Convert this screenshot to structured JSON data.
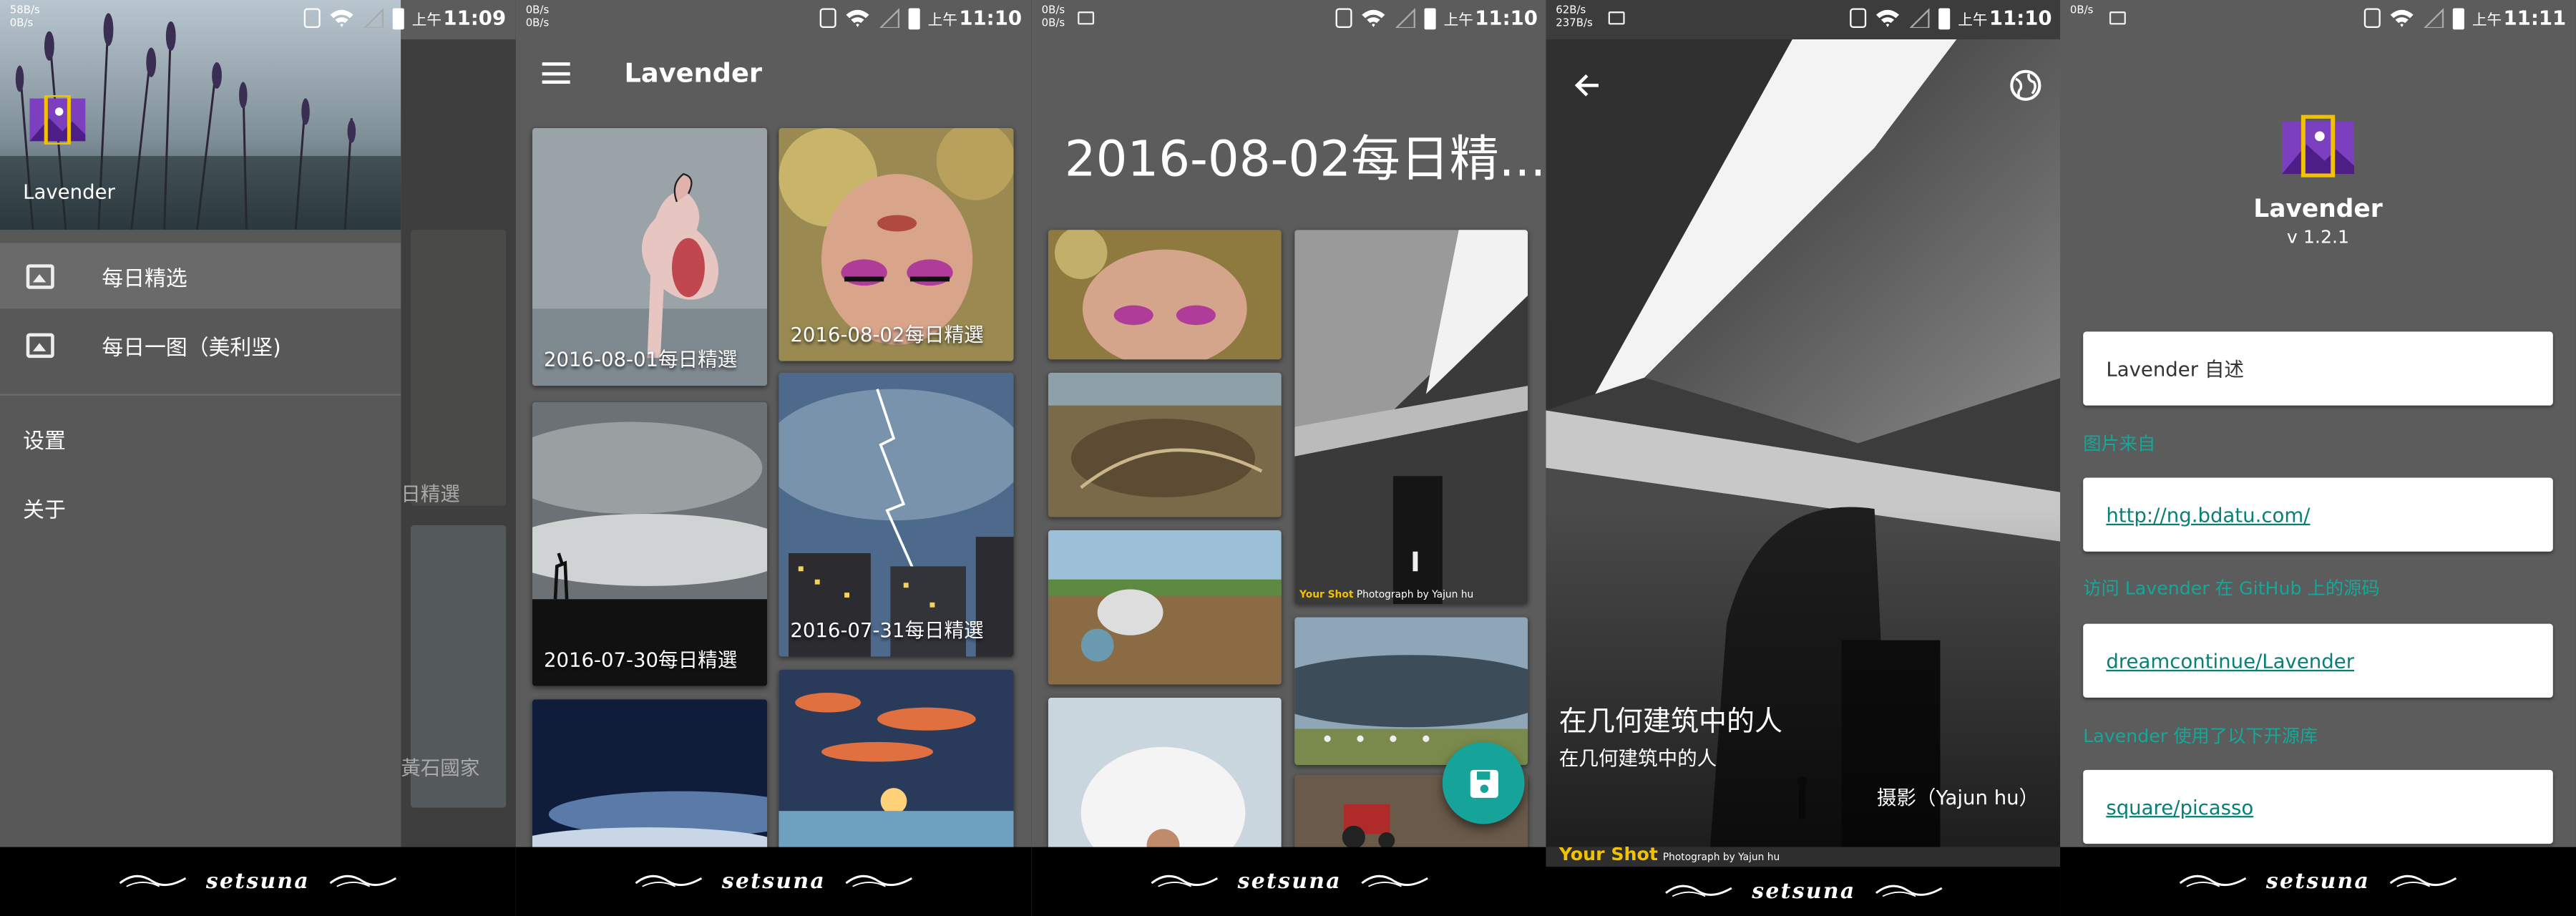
{
  "colors": {
    "panel_bg": "#5c5c5c",
    "drawer_bg": "#585858",
    "accent": "#16a39a",
    "logo_purple": "#7b3fbf",
    "logo_gold": "#f2c200",
    "nav_bar": "#000000"
  },
  "nav_brand": "setsuna",
  "screens": [
    {
      "status": {
        "speed_up": "58B/s",
        "speed_down": "0B/s",
        "ampm": "上午",
        "time": "11:09"
      },
      "drawer": {
        "app_name": "Lavender",
        "menu": [
          {
            "label": "每日精选",
            "icon": "image-icon",
            "selected": true
          },
          {
            "label": "每日一图（美利坚)",
            "icon": "image-icon",
            "selected": false
          }
        ],
        "settings_label": "设置",
        "about_label": "关于"
      },
      "behind_captions": [
        "日精選",
        "黃石國家"
      ]
    },
    {
      "status": {
        "speed_up": "0B/s",
        "speed_down": "0B/s",
        "ampm": "上午",
        "time": "11:10"
      },
      "toolbar_title": "Lavender",
      "cards": [
        {
          "caption": "2016-08-01每日精選"
        },
        {
          "caption": "2016-08-02每日精選"
        },
        {
          "caption": "2016-07-30每日精選"
        },
        {
          "caption": "2016-07-31每日精選"
        }
      ]
    },
    {
      "status": {
        "speed_up": "0B/s",
        "speed_down": "0B/s",
        "ampm": "上午",
        "time": "11:10"
      },
      "title": "2016-08-02每日精...",
      "photo_credit_brand": "Your Shot",
      "photo_credit_text": "Photograph by Yajun hu"
    },
    {
      "status": {
        "speed_up": "62B/s",
        "speed_down": "237B/s",
        "ampm": "上午",
        "time": "11:10"
      },
      "photo_title": "在几何建筑中的人",
      "photo_subtitle": "在几何建筑中的人",
      "photographer": "摄影（Yajun hu）",
      "credit_brand": "Your Shot",
      "credit_text": "Photograph by Yajun hu"
    },
    {
      "status": {
        "speed_up": "0B/s",
        "speed_down": "",
        "ampm": "上午",
        "time": "11:11"
      },
      "app_name": "Lavender",
      "version": "v 1.2.1",
      "items": [
        {
          "heading": "",
          "text": "Lavender 自述",
          "link": false
        },
        {
          "heading": "图片来自",
          "text": "http://ng.bdatu.com/",
          "link": true
        },
        {
          "heading": "访问 Lavender 在 GitHub 上的源码",
          "text": "dreamcontinue/Lavender",
          "link": true
        },
        {
          "heading": "Lavender 使用了以下开源库",
          "text": "square/picasso",
          "link": true
        }
      ]
    }
  ]
}
